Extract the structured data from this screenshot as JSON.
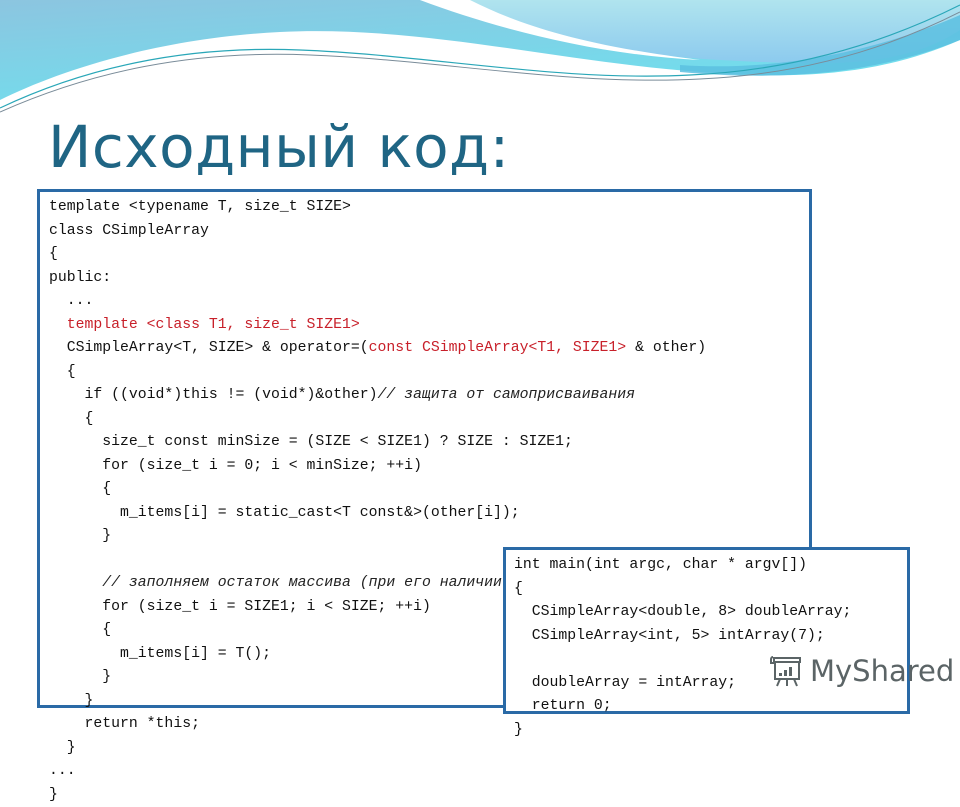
{
  "slide": {
    "title": "Исходный код:",
    "colors": {
      "title": "#1f6584",
      "box_border": "#2a6aa6",
      "keyword_highlight": "#c8202a",
      "wave_light": "#a7dff0",
      "wave_mid": "#6fd3e8",
      "wave_dark": "#4fb7de"
    }
  },
  "class_code": {
    "lines": [
      [
        {
          "t": "template <typename T, size_t SIZE>",
          "s": "plain"
        }
      ],
      [
        {
          "t": "class CSimpleArray",
          "s": "plain"
        }
      ],
      [
        {
          "t": "{",
          "s": "plain"
        }
      ],
      [
        {
          "t": "public:",
          "s": "plain"
        }
      ],
      [
        {
          "t": "  ...",
          "s": "plain"
        }
      ],
      [
        {
          "t": "  template <class T1, size_t SIZE1>",
          "s": "red"
        }
      ],
      [
        {
          "t": "  CSimpleArray<T, SIZE> & operator=(",
          "s": "plain"
        },
        {
          "t": "const CSimpleArray<T1, SIZE1>",
          "s": "red"
        },
        {
          "t": " & other)",
          "s": "plain"
        }
      ],
      [
        {
          "t": "  {",
          "s": "plain"
        }
      ],
      [
        {
          "t": "    if ((void*)this != (void*)&other)",
          "s": "plain"
        },
        {
          "t": "// защита от самоприсваивания",
          "s": "comment"
        }
      ],
      [
        {
          "t": "    {",
          "s": "plain"
        }
      ],
      [
        {
          "t": "      size_t const minSize = (SIZE < SIZE1) ? SIZE : SIZE1;",
          "s": "plain"
        }
      ],
      [
        {
          "t": "      for (size_t i = 0; i < minSize; ++i)",
          "s": "plain"
        }
      ],
      [
        {
          "t": "      {",
          "s": "plain"
        }
      ],
      [
        {
          "t": "        m_items[i] = static_cast<T const&>(other[i]);",
          "s": "plain"
        }
      ],
      [
        {
          "t": "      }",
          "s": "plain"
        }
      ],
      [
        {
          "t": "",
          "s": "plain"
        }
      ],
      [
        {
          "t": "      // заполняем остаток массива (при его наличии) значениями по умолчанию",
          "s": "comment"
        }
      ],
      [
        {
          "t": "      for (size_t i = SIZE1; i < SIZE; ++i)",
          "s": "plain"
        }
      ],
      [
        {
          "t": "      {",
          "s": "plain"
        }
      ],
      [
        {
          "t": "        m_items[i] = T();",
          "s": "plain"
        }
      ],
      [
        {
          "t": "      }",
          "s": "plain"
        }
      ],
      [
        {
          "t": "    }",
          "s": "plain"
        }
      ],
      [
        {
          "t": "    return *this;",
          "s": "plain"
        }
      ],
      [
        {
          "t": "  }",
          "s": "plain"
        }
      ],
      [
        {
          "t": "...",
          "s": "plain"
        }
      ],
      [
        {
          "t": "}",
          "s": "plain"
        }
      ]
    ]
  },
  "main_code": {
    "lines": [
      [
        {
          "t": "int main(int argc, char * argv[])",
          "s": "plain"
        }
      ],
      [
        {
          "t": "{",
          "s": "plain"
        }
      ],
      [
        {
          "t": "  CSimpleArray<double, 8> doubleArray;",
          "s": "plain"
        }
      ],
      [
        {
          "t": "  CSimpleArray<int, 5> intArray(7);",
          "s": "plain"
        }
      ],
      [
        {
          "t": "",
          "s": "plain"
        }
      ],
      [
        {
          "t": "  doubleArray = intArray;",
          "s": "plain"
        }
      ],
      [
        {
          "t": "  return 0;",
          "s": "plain"
        }
      ],
      [
        {
          "t": "}",
          "s": "plain"
        }
      ]
    ]
  },
  "watermark": {
    "icon": "presentation-chart-icon",
    "text": "MyShared"
  }
}
